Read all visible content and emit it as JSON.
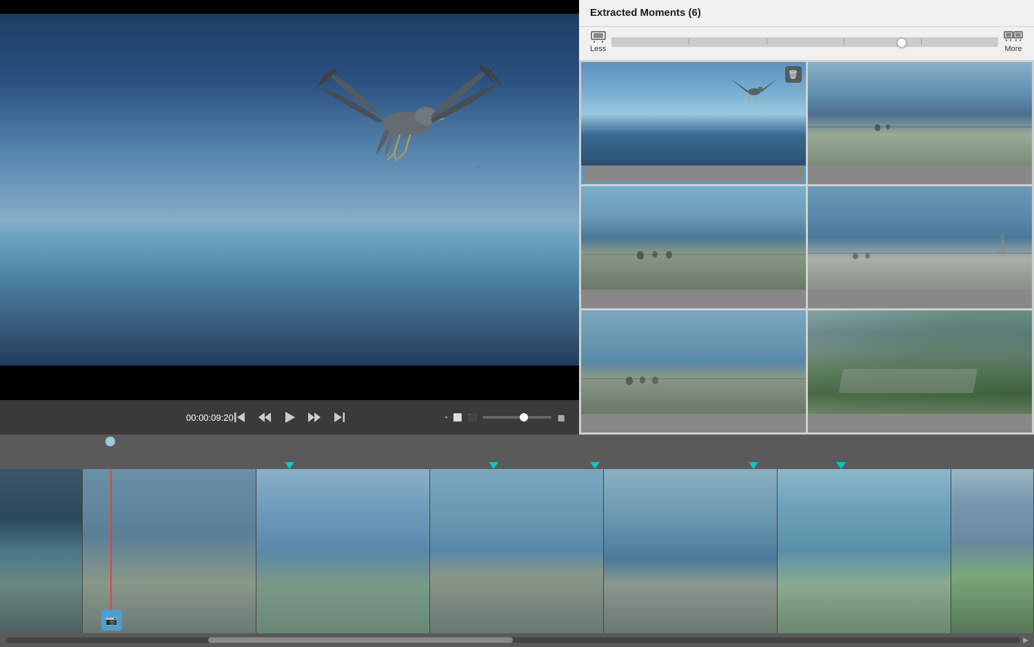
{
  "panel": {
    "title": "Extracted Moments (6)",
    "slider": {
      "less_label": "Less",
      "more_label": "More"
    }
  },
  "moments": [
    {
      "id": 1,
      "selected": true,
      "has_delete": true
    },
    {
      "id": 2,
      "selected": false,
      "has_delete": false
    },
    {
      "id": 3,
      "selected": false,
      "has_delete": false
    },
    {
      "id": 4,
      "selected": false,
      "has_delete": false
    },
    {
      "id": 5,
      "selected": false,
      "has_delete": false
    },
    {
      "id": 6,
      "selected": false,
      "has_delete": false
    }
  ],
  "controls": {
    "time": "00:00:09:20"
  },
  "timeline": {
    "markers": [
      {
        "pos": 420
      },
      {
        "pos": 716
      },
      {
        "pos": 863
      },
      {
        "pos": 1093
      },
      {
        "pos": 1220
      }
    ]
  }
}
